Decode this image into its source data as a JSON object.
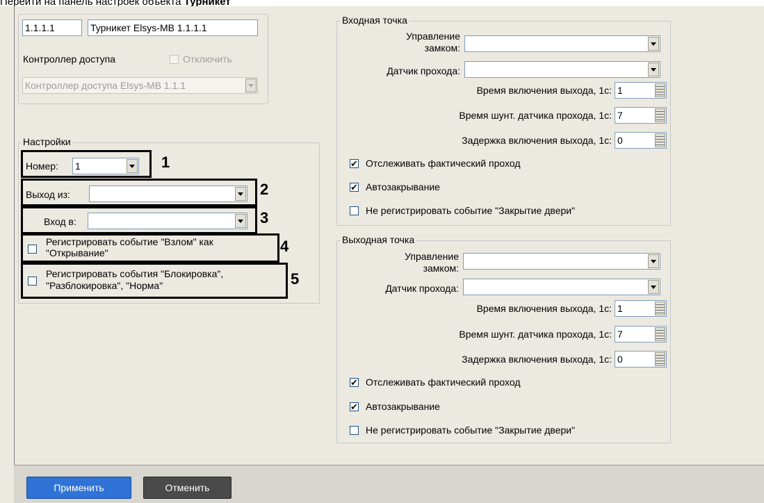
{
  "caption": {
    "text": "Перейти на панель настроек объекта ",
    "bold": "Турникет"
  },
  "header": {
    "id": "1.1.1.1",
    "name": "Турникет Elsys-MB 1.1.1.1",
    "parent_label": "Контроллер доступа",
    "disable_label": "Отключить",
    "parent_value": "Контроллер доступа Elsys-MB 1.1.1"
  },
  "settings": {
    "title": "Настройки",
    "number_label": "Номер:",
    "number_value": "1",
    "exit_from_label": "Выход из:",
    "exit_from_value": "",
    "enter_to_label": "Вход в:",
    "enter_to_value": "",
    "reg_breach_label_1": "Регистрировать событие \"Взлом\" как",
    "reg_breach_label_2": "\"Открывание\"",
    "reg_block_label_1": "Регистрировать события \"Блокировка\",",
    "reg_block_label_2": "\"Разблокировка\", \"Норма\""
  },
  "markers": [
    "1",
    "2",
    "3",
    "4",
    "5"
  ],
  "entry_point": {
    "title": "Входная точка",
    "lock_label_1": "Управление",
    "lock_label_2": "замком:",
    "lock_value": "",
    "sensor_label": "Датчик прохода:",
    "sensor_value": "",
    "on_time_label": "Время включения выхода, 1с:",
    "on_time_value": "1",
    "shunt_time_label": "Время шунт. датчика прохода, 1с:",
    "shunt_time_value": "7",
    "delay_label": "Задержка включения выхода, 1с:",
    "delay_value": "0",
    "track_label": "Отслеживать фактический проход",
    "autoclose_label": "Автозакрывание",
    "no_close_event_label": "Не регистрировать событие \"Закрытие двери\""
  },
  "exit_point": {
    "title": "Выходная точка",
    "lock_label_1": "Управление",
    "lock_label_2": "замком:",
    "lock_value": "",
    "sensor_label": "Датчик прохода:",
    "sensor_value": "",
    "on_time_label": "Время включения выхода, 1с:",
    "on_time_value": "1",
    "shunt_time_label": "Время шунт. датчика прохода, 1с:",
    "shunt_time_value": "7",
    "delay_label": "Задержка включения выхода, 1с:",
    "delay_value": "0",
    "track_label": "Отслеживать фактический проход",
    "autoclose_label": "Автозакрывание",
    "no_close_event_label": "Не регистрировать событие \"Закрытие двери\""
  },
  "checks": {
    "check_mark": "✔",
    "empty": ""
  },
  "buttons": {
    "apply": "Применить",
    "cancel": "Отменить"
  }
}
